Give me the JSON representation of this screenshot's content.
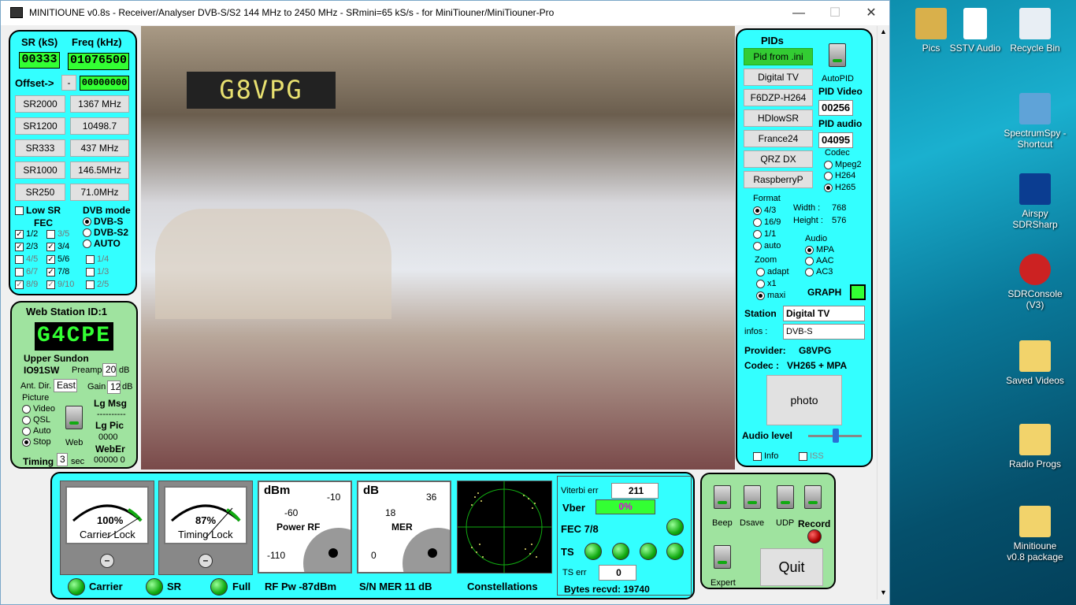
{
  "window": {
    "title": "MINITIOUNE v0.8s - Receiver/Analyser DVB-S/S2 144 MHz to 2450 MHz - SRmini=65 kS/s - for MiniTiouner/MiniTiouner-Pro",
    "minimize": "—",
    "maximize": "☐",
    "close": "✕"
  },
  "left": {
    "sr_label": "SR (kS)",
    "freq_label": "Freq (kHz)",
    "sr_value": "00333",
    "freq_value": "01076500",
    "offset_label": "Offset->",
    "offset_sign": "-",
    "offset_value": "00000000",
    "sr_buttons": [
      "SR2000",
      "SR1200",
      "SR333",
      "SR1000",
      "SR250"
    ],
    "freq_buttons": [
      "1367 MHz",
      "10498.7",
      "437 MHz",
      "146.5MHz",
      "71.0MHz"
    ],
    "low_sr": "Low SR",
    "dvb_mode": "DVB mode",
    "fec": "FEC",
    "dvb_options": [
      "DVB-S",
      "DVB-S2",
      "AUTO"
    ],
    "fec_items": [
      [
        "1/2",
        "3/5"
      ],
      [
        "2/3",
        "3/4"
      ],
      [
        "4/5",
        "5/6"
      ],
      [
        "6/7",
        "7/8"
      ],
      [
        "8/9",
        "9/10"
      ]
    ],
    "fec_extra": [
      "1/4",
      "1/3",
      "2/5"
    ]
  },
  "station": {
    "title": "Web Station ID:1",
    "callsign": "G4CPE",
    "place": "Upper Sundon",
    "locator": "IO91SW",
    "preamp_label": "Preamp",
    "preamp": "20",
    "db": "dB",
    "ant_label": "Ant. Dir.",
    "ant": "East",
    "gain_label": "Gain",
    "gain": "12",
    "picture": "Picture",
    "pic_opts": [
      "Video",
      "QSL",
      "Auto",
      "Stop"
    ],
    "web": "Web",
    "lg_msg": "Lg Msg",
    "dash": "----------",
    "lg_pic": "Lg Pic",
    "lg_pic_v": "0000",
    "weber": "WebEr",
    "weber_v": "00000  0",
    "timing": "Timing",
    "timing_v": "3",
    "sec": "sec"
  },
  "video": {
    "overlay": "G8VPG"
  },
  "right": {
    "pids": "PIDs",
    "pid_btn": "Pid from .ini",
    "presets": [
      "Digital TV",
      "F6DZP-H264",
      "HDlowSR",
      "France24",
      "QRZ DX",
      "RaspberryP"
    ],
    "autopid": "AutoPID",
    "pid_video_lbl": "PID Video",
    "pid_video": "00256",
    "pid_audio_lbl": "PID audio",
    "pid_audio": "04095",
    "codec": "Codec",
    "codec_opts": [
      "Mpeg2",
      "H264",
      "H265"
    ],
    "format": "Format",
    "format_opts": [
      "4/3",
      "16/9",
      "1/1",
      "auto"
    ],
    "width_lbl": "Width :",
    "width": "768",
    "height_lbl": "Height :",
    "height": "576",
    "audio": "Audio",
    "audio_opts": [
      "MPA",
      "AAC",
      "AC3"
    ],
    "zoom": "Zoom",
    "zoom_opts": [
      "adapt",
      "x1",
      "maxi"
    ],
    "graph": "GRAPH",
    "station_lbl": "Station",
    "station": "Digital TV",
    "infos_lbl": "infos :",
    "infos": "DVB-S",
    "provider_lbl": "Provider:",
    "provider": "G8VPG",
    "codec_lbl": "Codec :",
    "codec_val": "VH265 + MPA",
    "photo": "photo",
    "audio_level": "Audio level",
    "info": "Info",
    "iss": "ISS"
  },
  "bottom": {
    "carrier_pct": "100%",
    "carrier_lock": "Carrier Lock",
    "timing_pct": "87%",
    "timing_lock": "Timing Lock",
    "dbm": "dBm",
    "dbm_m10": "-10",
    "dbm_m60": "-60",
    "dbm_m110": "-110",
    "power_rf": "Power RF",
    "db": "dB",
    "db36": "36",
    "db18": "18",
    "db0": "0",
    "mer": "MER",
    "leds": [
      "Carrier",
      "SR",
      "Full"
    ],
    "rf_pw": "RF Pw -87dBm",
    "sn_mer": "S/N MER  11 dB",
    "constellations": "Constellations",
    "viterbi_lbl": "Viterbi err",
    "viterbi": "211",
    "vber_lbl": "Vber",
    "vber": "0%",
    "fec": "FEC 7/8",
    "ts": "TS",
    "ts_err_lbl": "TS err",
    "ts_err": "0",
    "bytes": "Bytes recvd:  19740",
    "switches": [
      "Beep",
      "Dsave",
      "UDP",
      "Record"
    ],
    "expert": "Expert",
    "quit": "Quit"
  },
  "desktop": {
    "icons": [
      "Pics",
      "SSTV Audio",
      "Recycle Bin",
      "SpectrumSpy - Shortcut",
      "Airspy SDRSharp",
      "SDRConsole (V3)",
      "Saved Videos",
      "Radio Progs",
      "Minitioune v0.8 package"
    ]
  },
  "colors": {
    "panel": "#33ffff",
    "lcd": "#33ff33",
    "video_tag_bg": "#222222",
    "video_tag_fg": "#e8e070"
  }
}
